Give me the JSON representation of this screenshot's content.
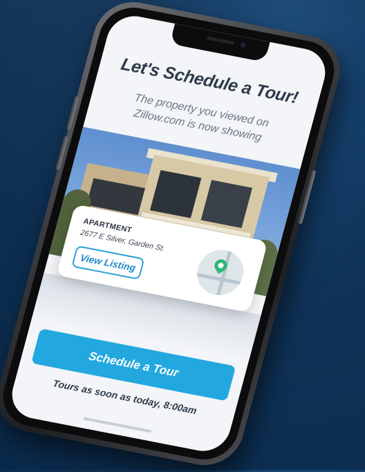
{
  "screen": {
    "title": "Let's Schedule a Tour!",
    "subtitle_line1": "The property you viewed on",
    "subtitle_line2": "Zillow.com is now showing"
  },
  "listing": {
    "type": "APARTMENT",
    "address": "2677 E Silver, Garden St.",
    "view_button": "View Listing"
  },
  "cta": {
    "label": "Schedule a Tour",
    "note": "Tours as soon as today, 8:00am"
  },
  "colors": {
    "accent": "#22a8df",
    "pin": "#2db87a",
    "background": "#0f3358"
  }
}
